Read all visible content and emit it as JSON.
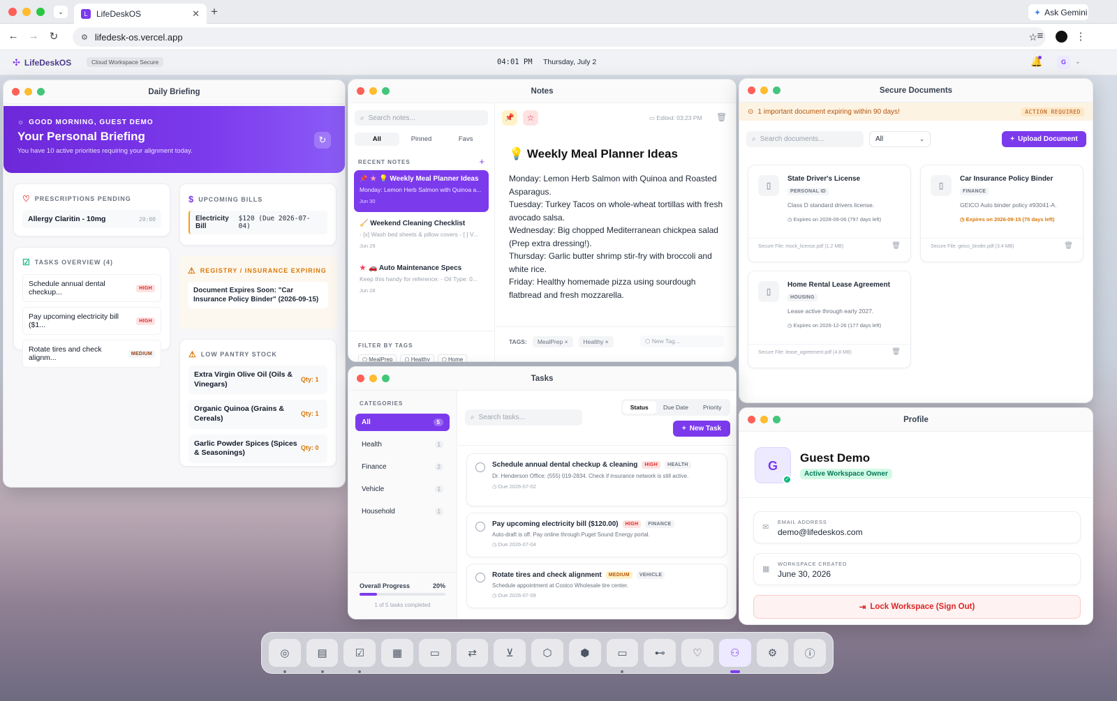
{
  "browser": {
    "tab_title": "LifeDeskOS",
    "tab_favicon": "L",
    "url": "lifedesk-os.vercel.app",
    "ask_gemini": "Ask Gemini"
  },
  "appbar": {
    "logo": "LifeDeskOS",
    "workspace_badge": "Cloud Workspace Secure",
    "time": "04:01 PM",
    "date": "Thursday, July 2",
    "avatar": "G"
  },
  "briefing": {
    "window_title": "Daily Briefing",
    "greeting": "GOOD MORNING, GUEST DEMO",
    "headline": "Your Personal Briefing",
    "subtitle": "You have 10 active priorities requiring your alignment today.",
    "prescriptions": {
      "title": "PRESCRIPTIONS PENDING",
      "items": [
        {
          "name": "Allergy Claritin - 10mg",
          "time": "20:00"
        }
      ]
    },
    "bills": {
      "title": "UPCOMING BILLS",
      "items": [
        {
          "name": "Electricity Bill",
          "value": "$120 (Due 2026-07-04)"
        }
      ]
    },
    "tasks": {
      "title": "TASKS OVERVIEW (4)",
      "items": [
        {
          "name": "Schedule annual dental checkup...",
          "badge": "HIGH"
        },
        {
          "name": "Pay upcoming electricity bill ($1...",
          "badge": "HIGH"
        },
        {
          "name": "Rotate tires and check alignm...",
          "badge": "MEDIUM"
        }
      ]
    },
    "registry": {
      "title": "REGISTRY / INSURANCE EXPIRING",
      "items": [
        {
          "name": "Document Expires Soon: \"Car Insurance Policy Binder\" (2026-09-15)"
        }
      ]
    },
    "pantry": {
      "title": "LOW PANTRY STOCK",
      "items": [
        {
          "name": "Extra Virgin Olive Oil (Oils & Vinegars)",
          "qty": "Qty: 1"
        },
        {
          "name": "Organic Quinoa (Grains & Cereals)",
          "qty": "Qty: 1"
        },
        {
          "name": "Garlic Powder Spices (Spices & Seasonings)",
          "qty": "Qty: 0"
        }
      ]
    }
  },
  "notes": {
    "window_title": "Notes",
    "search_placeholder": "Search notes...",
    "tabs": [
      "All",
      "Pinned",
      "Favs"
    ],
    "recent_label": "RECENT NOTES",
    "list": [
      {
        "title": "💡 Weekly Meal Planner Ideas",
        "preview": "Monday: Lemon Herb Salmon with Quinoa a...",
        "date": "Jun 30"
      },
      {
        "title": "🧹 Weekend Cleaning Checklist",
        "preview": "- [x] Wash bed sheets & pillow covers - [ ] V...",
        "date": "Jun 29"
      },
      {
        "title": "🚗 Auto Maintenance Specs",
        "preview": "Keep this handy for reference: - Oil Type: 0...",
        "date": "Jun 28"
      }
    ],
    "filter_label": "FILTER BY TAGS",
    "filter_tags": [
      "MealPrep",
      "Healthy",
      "Home"
    ],
    "edited": "Edited: 03:23 PM",
    "editor_title": "💡 Weekly Meal Planner Ideas",
    "editor_lines": [
      "Monday: Lemon Herb Salmon with Quinoa and Roasted Asparagus.",
      "Tuesday: Turkey Tacos on whole-wheat tortillas with fresh avocado salsa.",
      "Wednesday: Big chopped Mediterranean chickpea salad (Prep extra dressing!).",
      "Thursday: Garlic butter shrimp stir-fry with broccoli and white rice.",
      "Friday: Healthy homemade pizza using sourdough flatbread and fresh mozzarella."
    ],
    "tags_label": "TAGS:",
    "tags": [
      "MealPrep",
      "Healthy"
    ],
    "new_tag_placeholder": "New Tag..."
  },
  "documents": {
    "window_title": "Secure Documents",
    "alert": "1 important document expiring within 90 days!",
    "alert_action": "ACTION REQUIRED",
    "search_placeholder": "Search documents...",
    "filter": "All",
    "upload": "Upload Document",
    "cards": [
      {
        "title": "State Driver's License",
        "tag": "PERSONAL ID",
        "desc": "Class D standard drivers license.",
        "expires": "Expires on 2028-09-06 (797 days left)",
        "file": "Secure File: mock_license.pdf (1.2 MB)",
        "urgent": false
      },
      {
        "title": "Car Insurance Policy Binder",
        "tag": "FINANCE",
        "desc": "GEICO Auto binder policy #93041-A.",
        "expires": "Expires on 2026-09-15 (75 days left)",
        "file": "Secure File: geico_binder.pdf (3.4 MB)",
        "urgent": true
      },
      {
        "title": "Home Rental Lease Agreement",
        "tag": "HOUSING",
        "desc": "Lease active through early 2027.",
        "expires": "Expires on 2026-12-26 (177 days left)",
        "file": "Secure File: lease_agreement.pdf (4.8 MB)",
        "urgent": false
      }
    ]
  },
  "tasks": {
    "window_title": "Tasks",
    "categories_label": "CATEGORIES",
    "categories": [
      {
        "name": "All",
        "count": "5"
      },
      {
        "name": "Health",
        "count": "1"
      },
      {
        "name": "Finance",
        "count": "2"
      },
      {
        "name": "Vehicle",
        "count": "1"
      },
      {
        "name": "Household",
        "count": "1"
      }
    ],
    "progress_label": "Overall Progress",
    "progress_value": "20%",
    "progress_fraction": 0.2,
    "progress_note": "1 of 5 tasks completed",
    "search_placeholder": "Search tasks...",
    "sort_tabs": [
      "Status",
      "Due Date",
      "Priority"
    ],
    "new_task": "New Task",
    "items": [
      {
        "title": "Schedule annual dental checkup & cleaning",
        "priority": "HIGH",
        "category": "HEALTH",
        "desc": "Dr. Henderson Office: (555) 019-2834. Check if insurance network is still active.",
        "due": "Due 2026-07-02"
      },
      {
        "title": "Pay upcoming electricity bill ($120.00)",
        "priority": "HIGH",
        "category": "FINANCE",
        "desc": "Auto-draft is off. Pay online through Puget Sound Energy portal.",
        "due": "Due 2026-07-04"
      },
      {
        "title": "Rotate tires and check alignment",
        "priority": "MEDIUM",
        "category": "VEHICLE",
        "desc": "Schedule appointment at Costco Wholesale tire center.",
        "due": "Due 2026-07-09"
      }
    ]
  },
  "profile": {
    "window_title": "Profile",
    "avatar": "G",
    "name": "Guest Demo",
    "role": "Active Workspace Owner",
    "email_label": "EMAIL ADDRESS",
    "email": "demo@lifedeskos.com",
    "created_label": "WORKSPACE CREATED",
    "created": "June 30, 2026",
    "sign_out": "Lock Workspace (Sign Out)"
  },
  "dock": {
    "items": [
      "compass-icon",
      "document-icon",
      "checkbox-icon",
      "calendar-icon",
      "card-icon",
      "transfer-icon",
      "cart-icon",
      "box-icon",
      "package-icon",
      "folder-icon",
      "car-icon",
      "heart-icon",
      "user-icon",
      "gear-icon",
      "info-icon"
    ]
  },
  "colors": {
    "accent": "#7c3aed",
    "high": "#dc2626",
    "warning": "#d97706"
  }
}
